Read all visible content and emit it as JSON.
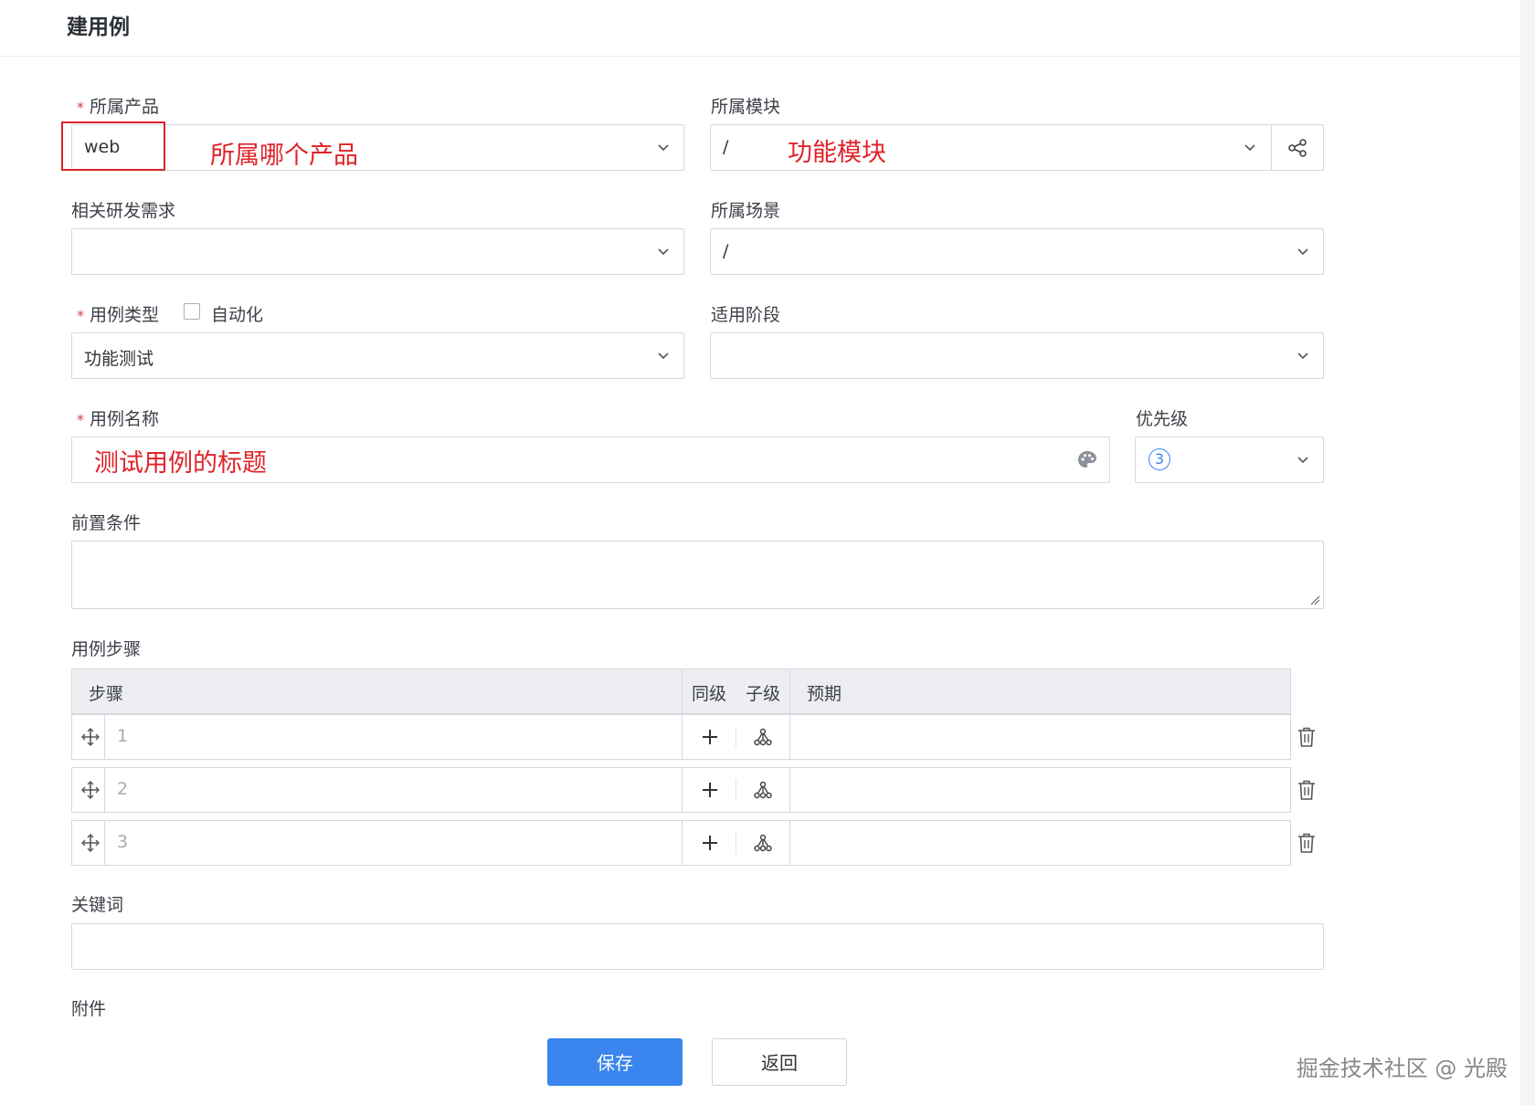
{
  "page": {
    "title": "建用例"
  },
  "form": {
    "product": {
      "label": "所属产品",
      "value": "web",
      "annotation": "所属哪个产品"
    },
    "module": {
      "label": "所属模块",
      "value": "/",
      "annotation": "功能模块"
    },
    "story": {
      "label": "相关研发需求",
      "value": ""
    },
    "scene": {
      "label": "所属场景",
      "value": "/"
    },
    "case_type": {
      "label": "用例类型",
      "checkbox_label": "自动化",
      "value": "功能测试"
    },
    "stage": {
      "label": "适用阶段",
      "value": ""
    },
    "case_name": {
      "label": "用例名称",
      "annotation": "测试用例的标题"
    },
    "priority": {
      "label": "优先级",
      "value": "3"
    },
    "precondition": {
      "label": "前置条件"
    },
    "steps": {
      "label": "用例步骤",
      "headers": {
        "step": "步骤",
        "same_level": "同级",
        "child_level": "子级",
        "expected": "预期"
      },
      "rows": [
        {
          "num": "1"
        },
        {
          "num": "2"
        },
        {
          "num": "3"
        }
      ]
    },
    "keywords": {
      "label": "关键词"
    },
    "attachment": {
      "label": "附件"
    }
  },
  "actions": {
    "save": "保存",
    "back": "返回"
  },
  "watermark": "掘金技术社区 @ 光殿",
  "colors": {
    "primary": "#3a85ee",
    "annotation_red": "#e0232a",
    "required": "#e0393e"
  }
}
